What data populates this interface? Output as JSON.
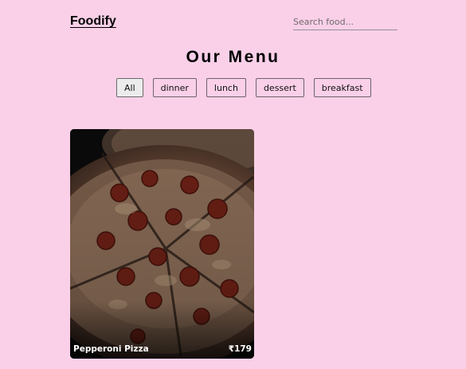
{
  "header": {
    "logo": "Foodify",
    "search_placeholder": "Search food..."
  },
  "menu": {
    "title": "Our Menu",
    "filters": [
      {
        "label": "All",
        "active": true
      },
      {
        "label": "dinner",
        "active": false
      },
      {
        "label": "lunch",
        "active": false
      },
      {
        "label": "dessert",
        "active": false
      },
      {
        "label": "breakfast",
        "active": false
      }
    ]
  },
  "items": [
    {
      "name": "Pepperoni Pizza",
      "price": "₹179",
      "image": "pepperoni-pizza-photo"
    }
  ],
  "colors": {
    "background": "#fad0e8",
    "card_overlay": "#000000"
  }
}
